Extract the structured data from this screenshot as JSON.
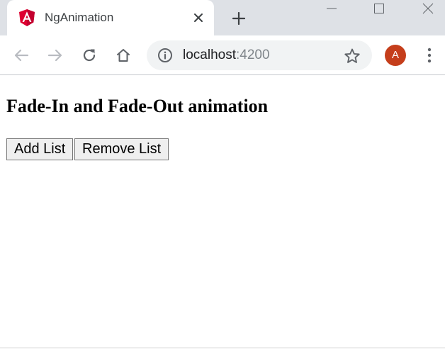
{
  "browser": {
    "tab": {
      "title": "NgAnimation",
      "favicon": "angular-logo-icon"
    },
    "address": {
      "host": "localhost",
      "port": ":4200"
    },
    "profile": {
      "initial": "A",
      "color": "#c53e1b"
    }
  },
  "page": {
    "heading": "Fade-In and Fade-Out animation",
    "buttons": {
      "add": "Add List",
      "remove": "Remove List"
    }
  },
  "colors": {
    "tabstrip": "#dee1e6",
    "omnibox": "#f1f3f4",
    "angular_red": "#dd0031",
    "icon_gray": "#5f6368"
  }
}
